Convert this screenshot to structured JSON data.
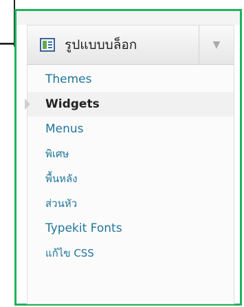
{
  "menu": {
    "title": "รูปแบบบล็อก",
    "items": [
      {
        "label": "Themes"
      },
      {
        "label": "Widgets"
      },
      {
        "label": "Menus"
      },
      {
        "label": "พิเศษ"
      },
      {
        "label": "พื้นหลัง"
      },
      {
        "label": "ส่วนหัว"
      },
      {
        "label": "Typekit Fonts"
      },
      {
        "label": "แก้ไข CSS"
      }
    ],
    "current_index": 1
  },
  "colors": {
    "frame": "#1fb35a",
    "link": "#21759b",
    "current_text": "#222222"
  },
  "icons": {
    "menu_icon": "appearance-icon",
    "toggle_icon": "triangle-down-icon"
  }
}
